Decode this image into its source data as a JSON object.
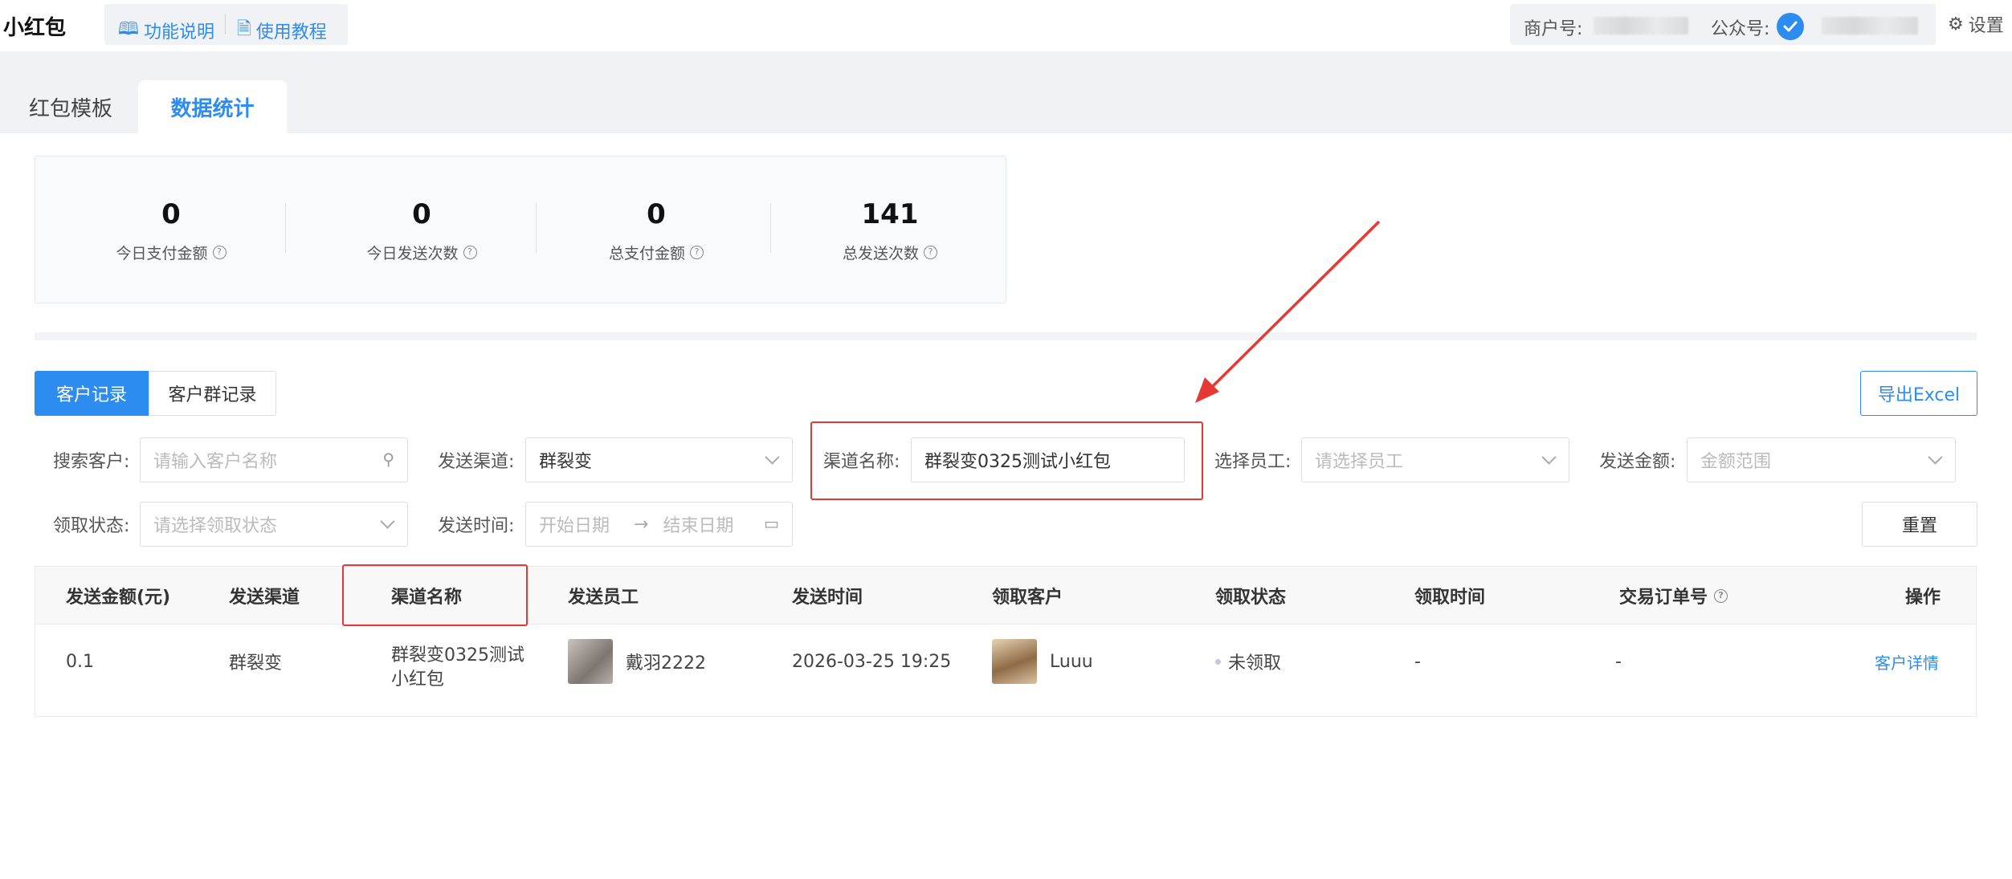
{
  "header": {
    "brand": "小红包",
    "help_links": [
      "功能说明",
      "使用教程"
    ],
    "merchant_label": "商户号:",
    "official_label": "公众号:",
    "settings_label": "设置"
  },
  "tabs": [
    "红包模板",
    "数据统计"
  ],
  "active_tab": "数据统计",
  "stats": [
    {
      "value": "0",
      "label": "今日支付金额"
    },
    {
      "value": "0",
      "label": "今日发送次数"
    },
    {
      "value": "0",
      "label": "总支付金额"
    },
    {
      "value": "141",
      "label": "总发送次数"
    }
  ],
  "record_tabs": [
    "客户记录",
    "客户群记录"
  ],
  "export_label": "导出Excel",
  "filters": {
    "search_label": "搜索客户:",
    "search_placeholder": "请输入客户名称",
    "channel_label": "发送渠道:",
    "channel_value": "群裂变",
    "channel_name_label": "渠道名称:",
    "channel_name_value": "群裂变0325测试小红包",
    "staff_label": "选择员工:",
    "staff_placeholder": "请选择员工",
    "amount_label": "发送金额:",
    "amount_placeholder": "金额范围",
    "status_label": "领取状态:",
    "status_placeholder": "请选择领取状态",
    "time_label": "发送时间:",
    "start_placeholder": "开始日期",
    "end_placeholder": "结束日期",
    "reset_label": "重置"
  },
  "table": {
    "columns": [
      "发送金额(元)",
      "发送渠道",
      "渠道名称",
      "发送员工",
      "发送时间",
      "领取客户",
      "领取状态",
      "领取时间",
      "交易订单号",
      "操作"
    ],
    "rows": [
      {
        "amount": "0.1",
        "channel": "群裂变",
        "channel_name_line1": "群裂变0325测试",
        "channel_name_line2": "小红包",
        "staff": "戴羽2222",
        "send_time": "2026-03-25 19:25",
        "customer": "Luuu",
        "status": "未领取",
        "receive_time": "-",
        "order_no": "-",
        "action": "客户详情"
      }
    ]
  },
  "colors": {
    "accent": "#2d8cf0",
    "highlight": "#e53935"
  }
}
